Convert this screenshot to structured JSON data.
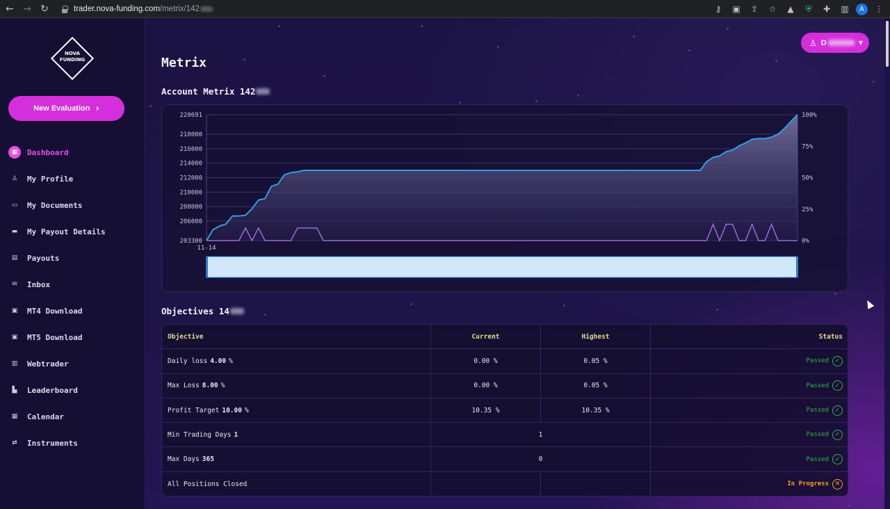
{
  "browser": {
    "url_host": "trader.nova-funding.com",
    "url_path": "/metrix/142"
  },
  "sidebar": {
    "logo_line1": "NOVA",
    "logo_line2": "FUNDING",
    "new_evaluation": "New Evaluation",
    "items": [
      {
        "label": "Dashboard",
        "icon": "dashboard-icon",
        "glyph": "▦",
        "active": true
      },
      {
        "label": "My Profile",
        "icon": "user-icon",
        "glyph": "♙"
      },
      {
        "label": "My Documents",
        "icon": "folder-icon",
        "glyph": "▭"
      },
      {
        "label": "My Payout Details",
        "icon": "card-icon",
        "glyph": "▬"
      },
      {
        "label": "Payouts",
        "icon": "cash-icon",
        "glyph": "▤"
      },
      {
        "label": "Inbox",
        "icon": "mail-icon",
        "glyph": "✉"
      },
      {
        "label": "MT4 Download",
        "icon": "download-icon",
        "glyph": "▣"
      },
      {
        "label": "MT5 Download",
        "icon": "download-icon",
        "glyph": "▣"
      },
      {
        "label": "Webtrader",
        "icon": "monitor-icon",
        "glyph": "▥"
      },
      {
        "label": "Leaderboard",
        "icon": "podium-icon",
        "glyph": "▙"
      },
      {
        "label": "Calendar",
        "icon": "calendar-icon",
        "glyph": "▦"
      },
      {
        "label": "Instruments",
        "icon": "swap-icon",
        "glyph": "⇄"
      }
    ]
  },
  "header": {
    "user_initial": "D"
  },
  "main": {
    "title": "Metrix",
    "account_title": "Account Metrix 142",
    "objectives_title": "Objectives 14"
  },
  "chart_data": {
    "type": "line",
    "x_first_label": "11-14",
    "y_left_ticks": [
      220691,
      218000,
      216000,
      214000,
      212000,
      210000,
      208000,
      206000,
      203300
    ],
    "y_left_range": [
      203300,
      220691
    ],
    "y_right_ticks": [
      "100%",
      "75%",
      "50%",
      "25%",
      "0%"
    ],
    "series": [
      {
        "values": [
          203300,
          204800,
          205300,
          205600,
          206700,
          206700,
          206800,
          207700,
          208900,
          209100,
          210800,
          211100,
          212400,
          212700,
          212800,
          213000,
          213000,
          213000,
          213000,
          213000,
          213000,
          213000,
          213000,
          213000,
          213000,
          213000,
          213000,
          213000,
          213000,
          213000,
          213000,
          213000,
          213000,
          213000,
          213000,
          213000,
          213000,
          213000,
          213000,
          213000,
          213000,
          213000,
          213000,
          213000,
          213000,
          213000,
          213000,
          213000,
          213000,
          213000,
          213000,
          213000,
          213000,
          213000,
          213000,
          213000,
          213000,
          213000,
          213000,
          213000,
          213000,
          213000,
          213000,
          213000,
          213000,
          213000,
          213000,
          213000,
          213000,
          213000,
          213000,
          213000,
          213000,
          213000,
          213000,
          213000,
          213000,
          214200,
          214800,
          215000,
          215600,
          215800,
          216400,
          216800,
          217300,
          217400,
          217400,
          217600,
          218000,
          218800,
          219800,
          220691
        ]
      },
      {
        "values": [
          0,
          0,
          0,
          0,
          0,
          0,
          10,
          0,
          10,
          0,
          0,
          0,
          0,
          0,
          10,
          10,
          10,
          10,
          0,
          0,
          0,
          0,
          0,
          0,
          0,
          0,
          0,
          0,
          0,
          0,
          0,
          0,
          0,
          0,
          0,
          0,
          0,
          0,
          0,
          0,
          0,
          0,
          0,
          0,
          0,
          0,
          0,
          0,
          0,
          0,
          0,
          0,
          0,
          0,
          0,
          0,
          0,
          0,
          0,
          0,
          0,
          0,
          0,
          0,
          0,
          0,
          0,
          0,
          0,
          0,
          0,
          0,
          0,
          0,
          0,
          0,
          0,
          0,
          13,
          0,
          13,
          13,
          0,
          0,
          13,
          0,
          0,
          13,
          0,
          0,
          0,
          0
        ]
      }
    ],
    "colors": {
      "equity": "#2ea0e0",
      "secondary": "#9b6bd8",
      "navigator": "#d3e7fb"
    }
  },
  "objectives": {
    "headers": {
      "objective": "Objective",
      "current": "Current",
      "highest": "Highest",
      "status": "Status"
    },
    "rows": [
      {
        "label": "Daily loss",
        "value": "4.00",
        "unit": "%",
        "current": "0.00 %",
        "highest": "0.05 %",
        "status": "Passed"
      },
      {
        "label": "Max Loss",
        "value": "8.00",
        "unit": "%",
        "current": "0.00 %",
        "highest": "0.05 %",
        "status": "Passed"
      },
      {
        "label": "Profit Target",
        "value": "10.00",
        "unit": "%",
        "current": "10.35 %",
        "highest": "10.35 %",
        "status": "Passed"
      },
      {
        "label": "Min Trading Days",
        "value": "1",
        "unit": "",
        "merged": "1",
        "status": "Passed"
      },
      {
        "label": "Max Days",
        "value": "365",
        "unit": "",
        "merged": "0",
        "status": "Passed"
      },
      {
        "label": "All Positions Closed",
        "value": "",
        "unit": "",
        "current": "",
        "highest": "",
        "status": "In Progress"
      }
    ]
  }
}
